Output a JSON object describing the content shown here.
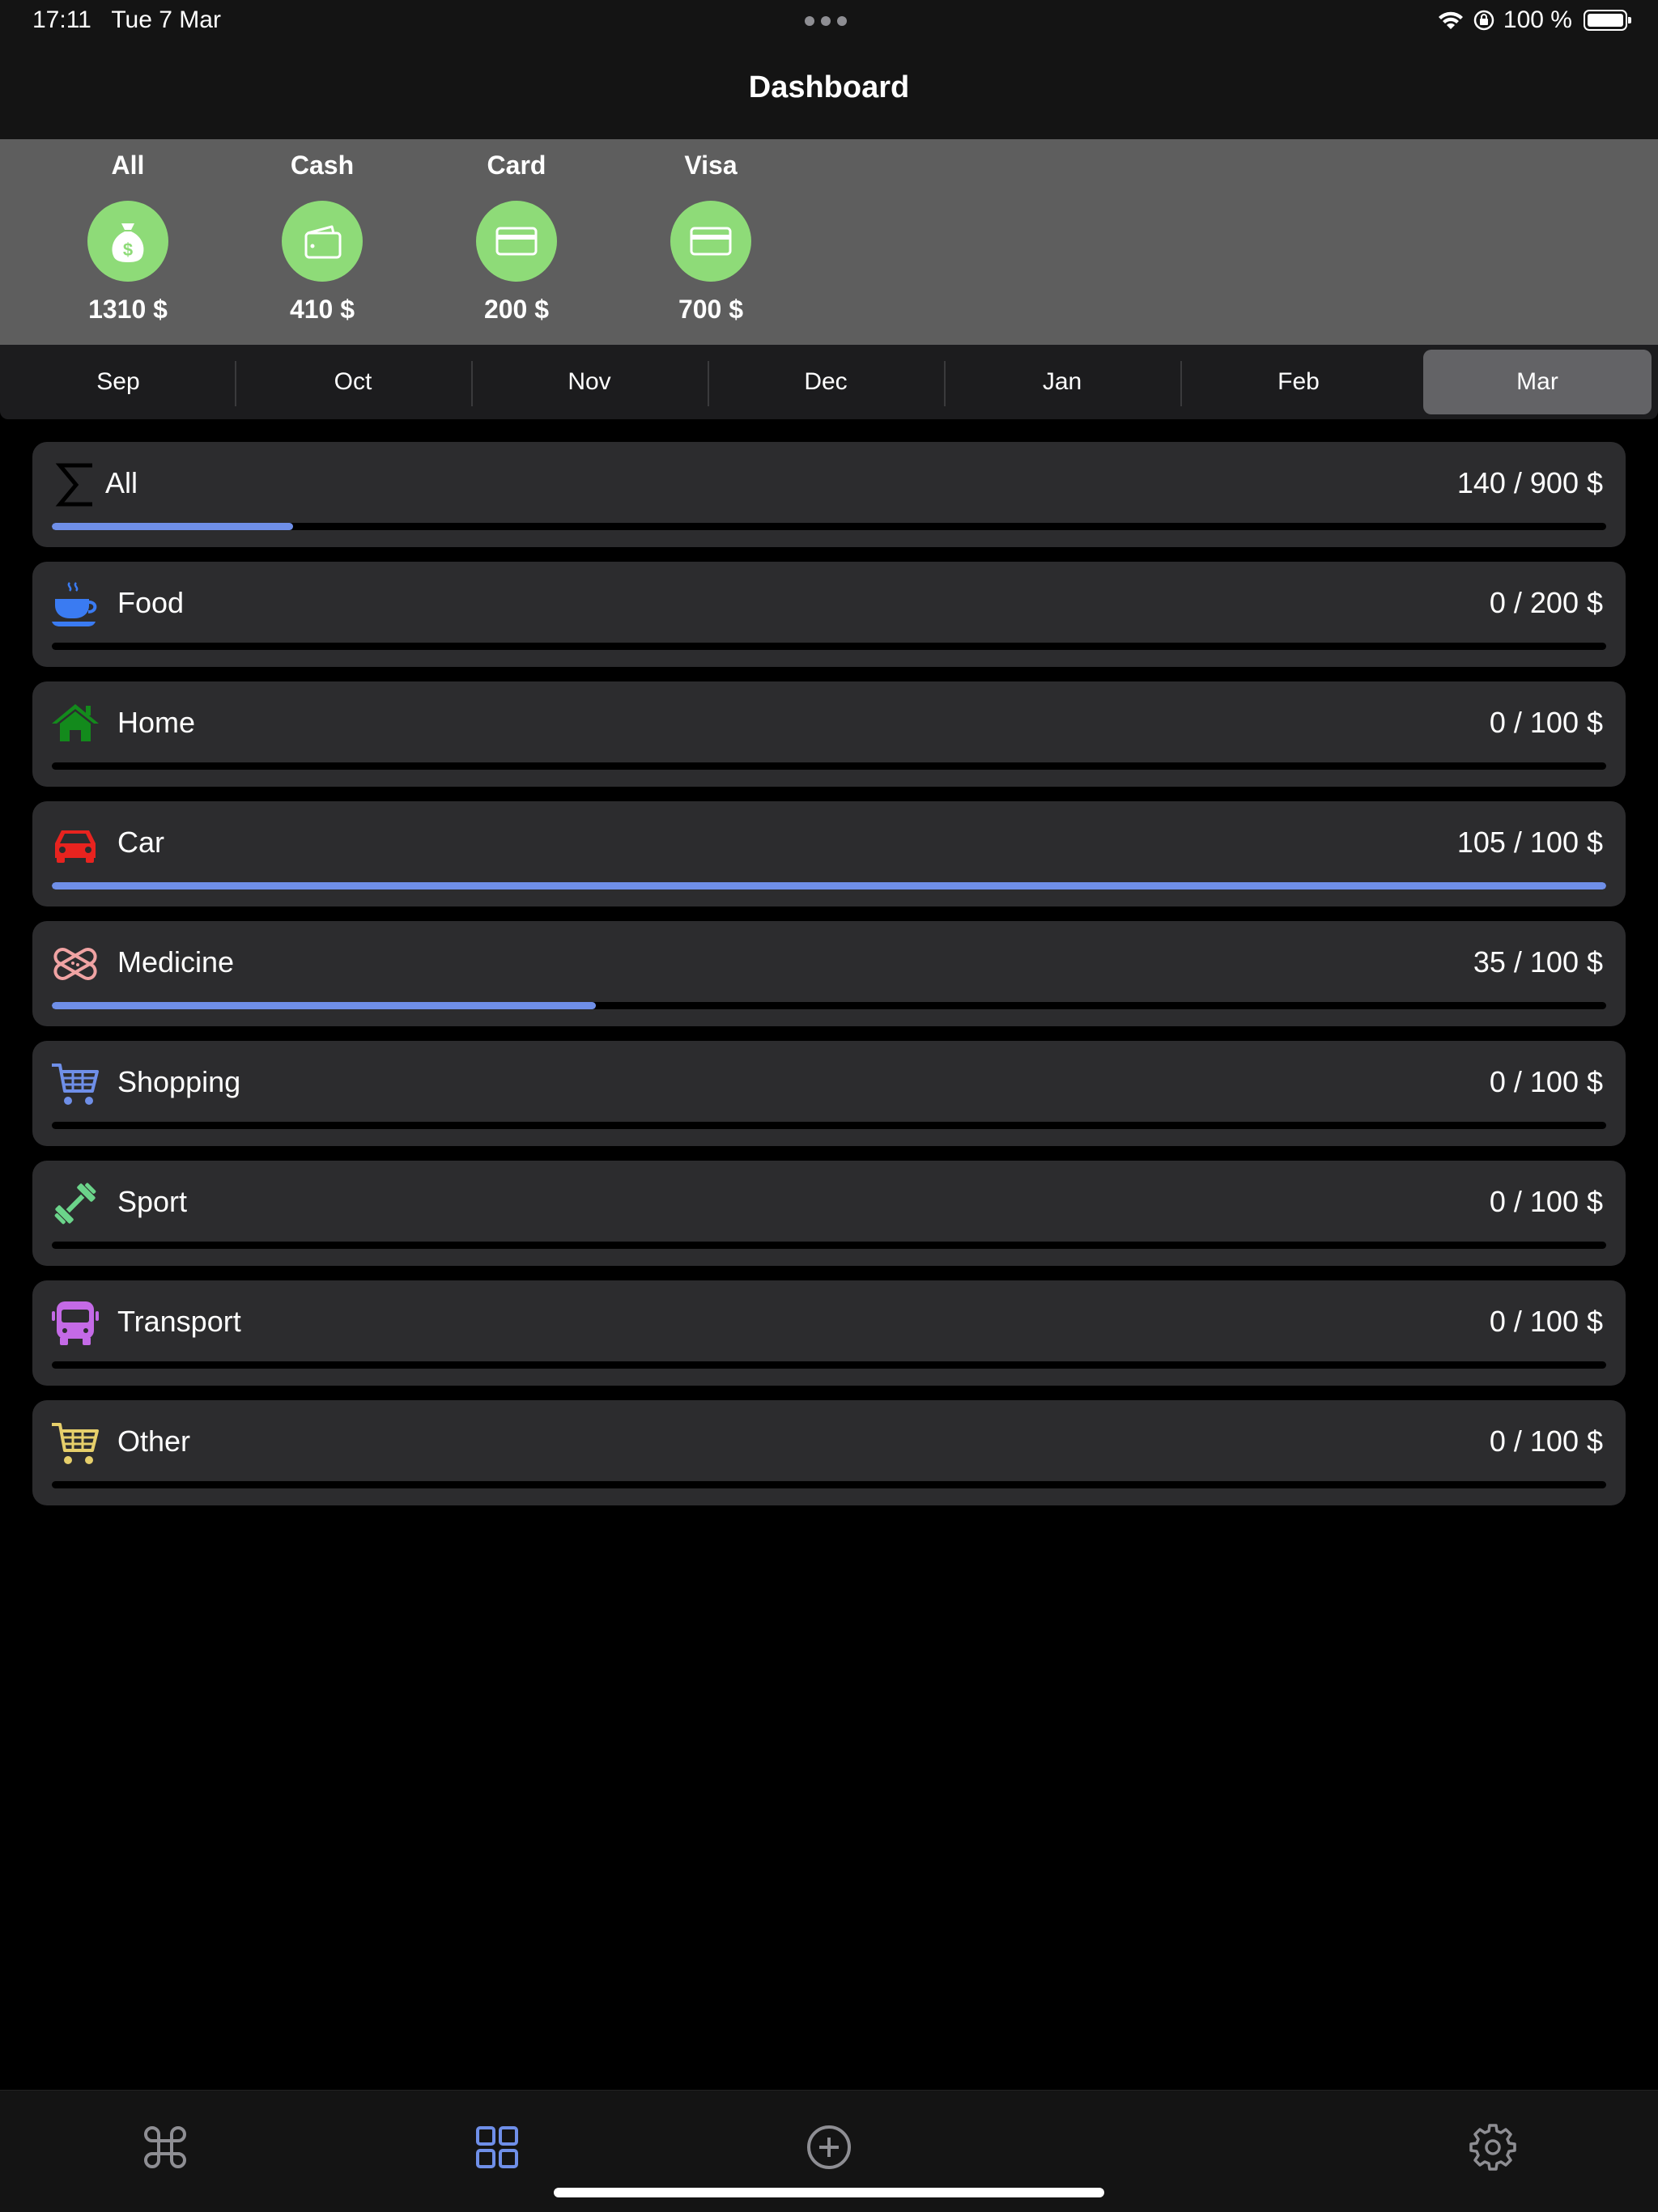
{
  "status_bar": {
    "time": "17:11",
    "date": "Tue 7 Mar",
    "battery": "100 %"
  },
  "nav": {
    "title": "Dashboard"
  },
  "accounts": [
    {
      "name": "All",
      "amount": "1310 $",
      "icon": "money-bag-icon"
    },
    {
      "name": "Cash",
      "amount": "410 $",
      "icon": "wallet-icon"
    },
    {
      "name": "Card",
      "amount": "200 $",
      "icon": "credit-card-icon"
    },
    {
      "name": "Visa",
      "amount": "700 $",
      "icon": "credit-card-icon"
    }
  ],
  "accent_color": "#8edb78",
  "progress_color": "#6f8fe8",
  "months": {
    "items": [
      "Sep",
      "Oct",
      "Nov",
      "Dec",
      "Jan",
      "Feb",
      "Mar"
    ],
    "selected": "Mar"
  },
  "categories": [
    {
      "name": "All",
      "amount": "140 / 900 $",
      "progress": 0.155,
      "icon": "sigma-icon",
      "color": "#000000"
    },
    {
      "name": "Food",
      "amount": "0 / 200 $",
      "progress": 0,
      "icon": "coffee-cup-icon",
      "color": "#3a7bf2"
    },
    {
      "name": "Home",
      "amount": "0 / 100 $",
      "progress": 0,
      "icon": "house-icon",
      "color": "#138a1c"
    },
    {
      "name": "Car",
      "amount": "105 / 100 $",
      "progress": 1.0,
      "icon": "car-icon",
      "color": "#e8231f"
    },
    {
      "name": "Medicine",
      "amount": "35 / 100 $",
      "progress": 0.35,
      "icon": "bandage-icon",
      "color": "#f0a3a3"
    },
    {
      "name": "Shopping",
      "amount": "0 / 100 $",
      "progress": 0,
      "icon": "shopping-cart-icon",
      "color": "#6f8fe8"
    },
    {
      "name": "Sport",
      "amount": "0 / 100 $",
      "progress": 0,
      "icon": "dumbbell-icon",
      "color": "#6bd48a"
    },
    {
      "name": "Transport",
      "amount": "0 / 100 $",
      "progress": 0,
      "icon": "bus-icon",
      "color": "#c46ae6"
    },
    {
      "name": "Other",
      "amount": "0 / 100 $",
      "progress": 0,
      "icon": "cart-icon",
      "color": "#e6cf6b"
    }
  ],
  "tab_bar": {
    "items": [
      {
        "name": "command-tab",
        "icon": "command-icon",
        "color": "#8e8e93"
      },
      {
        "name": "dashboard-tab",
        "icon": "grid-icon",
        "color": "#6f8fe8",
        "selected": true
      },
      {
        "name": "add-tab",
        "icon": "plus-circle-icon",
        "color": "#8e8e93"
      },
      {
        "name": "settings-tab",
        "icon": "gear-icon",
        "color": "#8e8e93"
      }
    ]
  }
}
